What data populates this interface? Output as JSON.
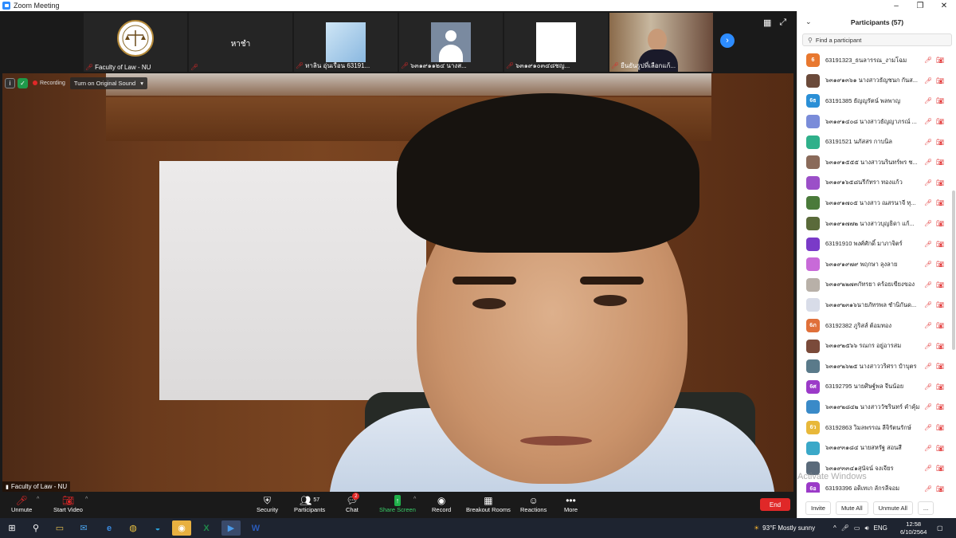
{
  "window": {
    "title": "Zoom Meeting",
    "minimize": "–",
    "maximize": "❐",
    "close": "✕"
  },
  "thumbnails": [
    {
      "name": "Faculty of Law - NU",
      "type": "logo"
    },
    {
      "name": "",
      "big_name": "หาชำ",
      "type": "text"
    },
    {
      "name": "ทาลิน อุ่นเรือน 63191...",
      "type": "anime"
    },
    {
      "name": "๖๓๑๙๑๑๒๔ นางส...",
      "type": "avatar"
    },
    {
      "name": "๖๓๑๙๑๐๓๔๘ชญ...",
      "type": "blank"
    },
    {
      "name": "ยืนยันรูปที่เลือกแก้...",
      "type": "person"
    }
  ],
  "video_overlay": {
    "recording_label": "Recording",
    "original_sound_label": "Turn on Original Sound",
    "speaker_label": "Faculty of Law - NU"
  },
  "toolbar": {
    "unmute": "Unmute",
    "start_video": "Start Video",
    "security": "Security",
    "participants": "Participants",
    "participants_count": "57",
    "chat": "Chat",
    "chat_badge": "2",
    "share_screen": "Share Screen",
    "record": "Record",
    "breakout_rooms": "Breakout Rooms",
    "reactions": "Reactions",
    "more": "More",
    "end": "End"
  },
  "panel": {
    "title": "Participants (57)",
    "search_placeholder": "Find a participant",
    "participants": [
      {
        "name": "63191323_ธนลารรณ_งามโฉม",
        "avatar": "6",
        "color": "#e8782f"
      },
      {
        "name": "๖๓๑๙๑๓๖๑ นางสาวธัญชนก กันส...",
        "avatar": "",
        "color": "#6b4a3a"
      },
      {
        "name": "63191385 ธัญญรัตน์ พลพาญ",
        "avatar": "6ธ",
        "color": "#2a8fd6"
      },
      {
        "name": "๖๓๑๙๑๔๐๘ นางสาวธัญญาภรณ์ ...",
        "avatar": "",
        "color": "#7a8cd9"
      },
      {
        "name": "63191521 นภัสสร กาบนิล",
        "avatar": "",
        "color": "#2fb08a"
      },
      {
        "name": "๖๓๑๙๑๕๕๕ นางสาวนรินทร์พร ช...",
        "avatar": "",
        "color": "#8a6a5a"
      },
      {
        "name": "๖๓๑๙๑๖๕๘นรีกัทรา ทองแก้ว",
        "avatar": "",
        "color": "#9b4fc8"
      },
      {
        "name": "๖๓๑๙๑๗๐๕ นางสาว ณสรนาจี ทุ...",
        "avatar": "",
        "color": "#4a7a3a"
      },
      {
        "name": "๖๓๑๙๑๗๗๒ นางสาวบุญธิดา แก้...",
        "avatar": "",
        "color": "#5a6a3a"
      },
      {
        "name": "63191910 พงศ์ศักดิ์ มาภาจิตร์",
        "avatar": "",
        "color": "#7a3ac8"
      },
      {
        "name": "๖๓๑๙๑๙๗๙ พฤกษา ลุงลาย",
        "avatar": "",
        "color": "#c86ad8"
      },
      {
        "name": "๖๓๑๙๒๒๗๓กัทรยา คร้อยเขียงของ",
        "avatar": "",
        "color": "#b8b0a8"
      },
      {
        "name": "๖๓๑๙๒๓๑๖นายภัทรพล ชำนิกันด...",
        "avatar": "",
        "color": "#d8dce8"
      },
      {
        "name": "63192382 ภูริสส์ ต้อมทอง",
        "avatar": "6ภ",
        "color": "#e0703a"
      },
      {
        "name": "๖๓๑๙๒๕๖๖ รณกร อยู่อารสม",
        "avatar": "",
        "color": "#7a4a3a"
      },
      {
        "name": "๖๓๑๙๒๖๒๕ นางสาววริศรา ปำบุตร",
        "avatar": "",
        "color": "#5a7a8a"
      },
      {
        "name": "63192795 นายศิษฐ์พล จีนน้อย",
        "avatar": "6ศ",
        "color": "#9b3ac8"
      },
      {
        "name": "๖๓๑๙๒๘๔๒ นางสาววัชรินทร์ คำคุ้ม",
        "avatar": "",
        "color": "#3a8ac8"
      },
      {
        "name": "63192863 วิมลพรรณ ลีจิรัตนรักษ์",
        "avatar": "6ว",
        "color": "#e8b83a"
      },
      {
        "name": "๖๓๑๙๓๑๘๔ นายสหรัฐ สอนสี",
        "avatar": "",
        "color": "#3aa8c8"
      },
      {
        "name": "๖๓๑๙๓๓๔๑สุนัจน์ จงเจียร",
        "avatar": "",
        "color": "#5a6a7a"
      },
      {
        "name": "63193396 อดิเทเก ลักรลีจอม",
        "avatar": "6อ",
        "color": "#9b3ac8"
      }
    ],
    "invite": "Invite",
    "mute_all": "Mute All",
    "unmute_all": "Unmute All",
    "more": "...",
    "watermark": "Activate Windows"
  },
  "taskbar": {
    "weather": "93°F  Mostly sunny",
    "lang": "ENG",
    "time": "12:58",
    "date": "6/10/2564"
  }
}
